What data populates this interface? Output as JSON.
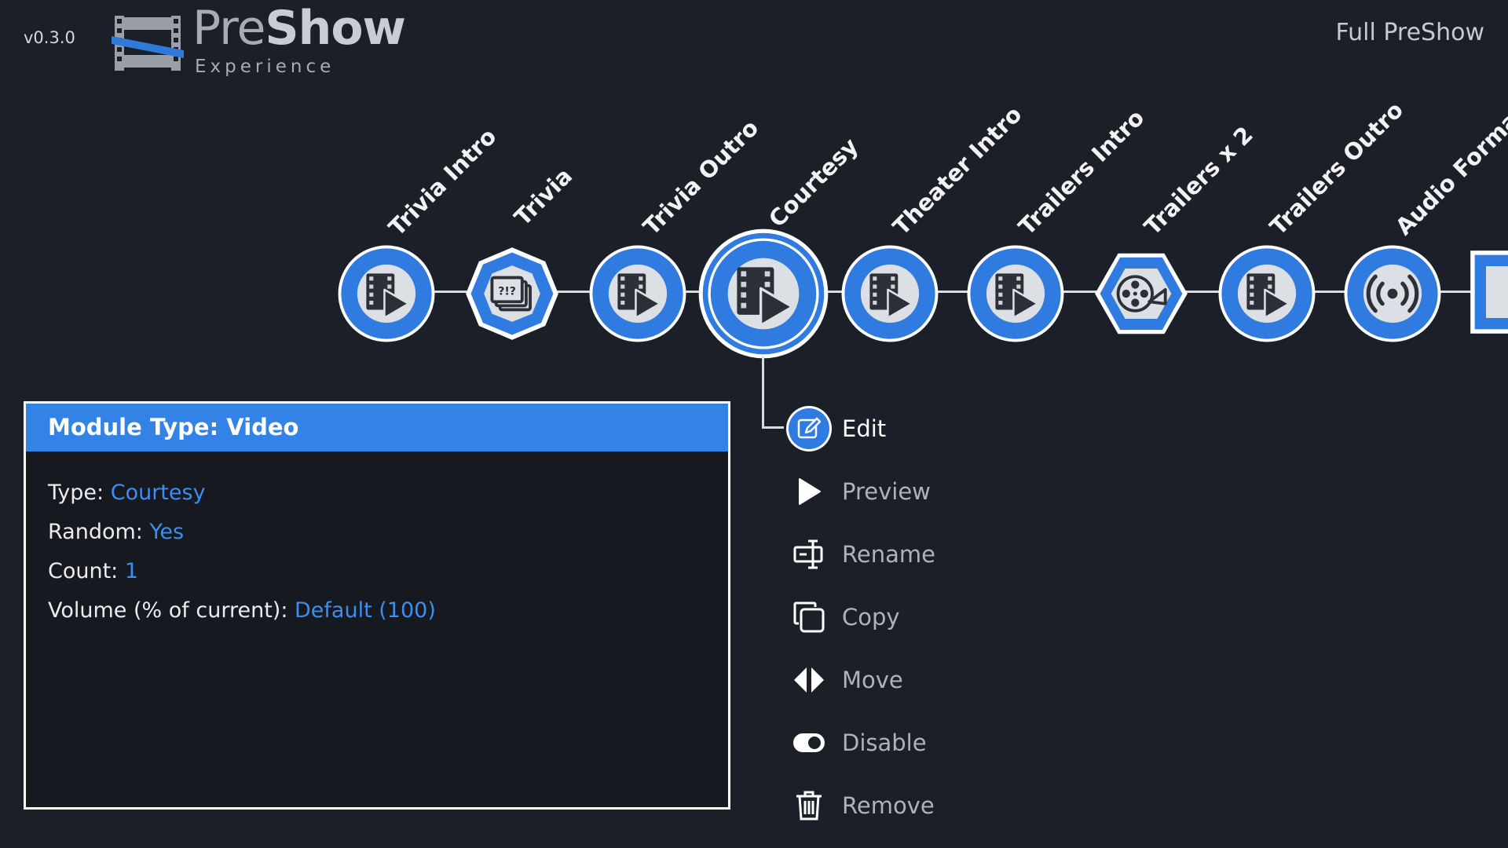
{
  "header": {
    "version": "v0.3.0",
    "logo_text_light": "Pre",
    "logo_text_bold": "Show",
    "logo_subtitle": "Experience",
    "sequence_name": "Full PreShow"
  },
  "timeline": {
    "items": [
      {
        "label": "Trivia Intro",
        "icon": "video-icon",
        "shape": "circle"
      },
      {
        "label": "Trivia",
        "icon": "trivia-slides-icon",
        "shape": "octagon"
      },
      {
        "label": "Trivia Outro",
        "icon": "video-icon",
        "shape": "circle"
      },
      {
        "label": "Courtesy",
        "icon": "video-icon",
        "shape": "circle",
        "selected": true
      },
      {
        "label": "Theater Intro",
        "icon": "video-icon",
        "shape": "circle"
      },
      {
        "label": "Trailers Intro",
        "icon": "video-icon",
        "shape": "circle"
      },
      {
        "label": "Trailers x 2",
        "icon": "film-reel-icon",
        "shape": "hexagon"
      },
      {
        "label": "Trailers Outro",
        "icon": "video-icon",
        "shape": "circle"
      },
      {
        "label": "Audio Format B",
        "icon": "audio-broadcast-icon",
        "shape": "circle"
      }
    ]
  },
  "info": {
    "title": "Module Type: Video",
    "rows": [
      {
        "label": "Type:",
        "value": "Courtesy"
      },
      {
        "label": "Random:",
        "value": "Yes"
      },
      {
        "label": "Count:",
        "value": "1"
      },
      {
        "label": "Volume (% of current):",
        "value": "Default (100)"
      }
    ]
  },
  "menu": {
    "items": [
      {
        "label": "Edit",
        "icon": "edit-icon",
        "active": true
      },
      {
        "label": "Preview",
        "icon": "play-icon"
      },
      {
        "label": "Rename",
        "icon": "rename-icon"
      },
      {
        "label": "Copy",
        "icon": "copy-icon"
      },
      {
        "label": "Move",
        "icon": "move-icon"
      },
      {
        "label": "Disable",
        "icon": "toggle-icon"
      },
      {
        "label": "Remove",
        "icon": "trash-icon"
      }
    ]
  },
  "colors": {
    "background": "#1b1f27",
    "accent": "#3382e6",
    "value_text": "#3d8ef2"
  }
}
